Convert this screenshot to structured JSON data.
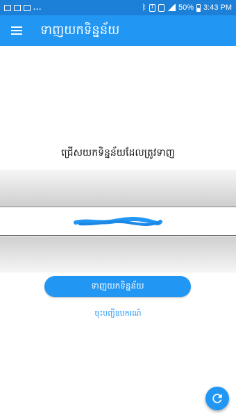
{
  "status_bar": {
    "left_overflow": "...",
    "battery": "50%",
    "time": "3:43 PM",
    "sim": "1"
  },
  "app_bar": {
    "title": "ទាញយកទិន្នន័យ"
  },
  "main": {
    "prompt": "ជ្រើសយកទិន្នន័យដែលត្រូវទាញ",
    "download_button_label": "ទាញយកទិន្នន័យ",
    "register_link_label": "ចុះបញ្ជីឧបករណ៍"
  },
  "colors": {
    "primary": "#2196f3",
    "status_bar": "#1c7fd8"
  },
  "icons": {
    "menu": "hamburger-menu-icon",
    "fab": "refresh-icon"
  }
}
